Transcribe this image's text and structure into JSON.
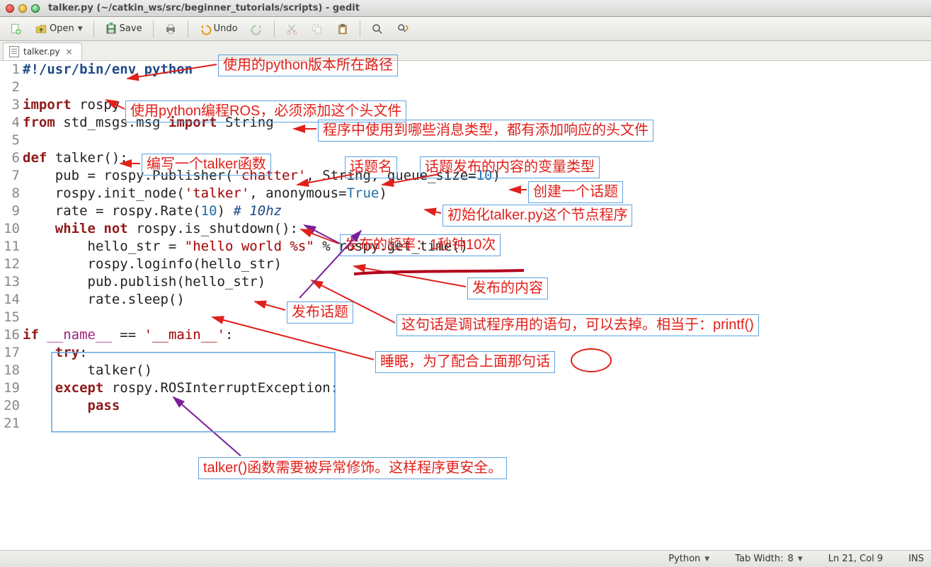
{
  "window": {
    "title": "talker.py (~/catkin_ws/src/beginner_tutorials/scripts) - gedit"
  },
  "toolbar": {
    "open": "Open",
    "save": "Save",
    "undo": "Undo"
  },
  "tabs": {
    "active": "talker.py"
  },
  "code": {
    "lines": [
      {
        "n": "1",
        "segs": [
          {
            "c": "sh",
            "t": "#!/usr/bin/env python"
          }
        ]
      },
      {
        "n": "2",
        "segs": [
          {
            "c": "plain",
            "t": " "
          }
        ]
      },
      {
        "n": "3",
        "segs": [
          {
            "c": "kw",
            "t": "import"
          },
          {
            "c": "plain",
            "t": " rospy"
          }
        ]
      },
      {
        "n": "4",
        "segs": [
          {
            "c": "kw",
            "t": "from"
          },
          {
            "c": "plain",
            "t": " std_msgs.msg "
          },
          {
            "c": "kw",
            "t": "import"
          },
          {
            "c": "plain",
            "t": " String"
          }
        ]
      },
      {
        "n": "5",
        "segs": [
          {
            "c": "plain",
            "t": " "
          }
        ]
      },
      {
        "n": "6",
        "segs": [
          {
            "c": "kw",
            "t": "def"
          },
          {
            "c": "plain",
            "t": " talker():"
          }
        ]
      },
      {
        "n": "7",
        "segs": [
          {
            "c": "plain",
            "t": "    pub = rospy.Publisher("
          },
          {
            "c": "str",
            "t": "'chatter'"
          },
          {
            "c": "plain",
            "t": ", String, queue_size="
          },
          {
            "c": "num",
            "t": "10"
          },
          {
            "c": "plain",
            "t": ")"
          }
        ]
      },
      {
        "n": "8",
        "segs": [
          {
            "c": "plain",
            "t": "    rospy.init_node("
          },
          {
            "c": "str",
            "t": "'talker'"
          },
          {
            "c": "plain",
            "t": ", anonymous="
          },
          {
            "c": "num",
            "t": "True"
          },
          {
            "c": "plain",
            "t": ")"
          }
        ]
      },
      {
        "n": "9",
        "segs": [
          {
            "c": "plain",
            "t": "    rate = rospy.Rate("
          },
          {
            "c": "num",
            "t": "10"
          },
          {
            "c": "plain",
            "t": ") "
          },
          {
            "c": "cmt",
            "t": "# 10hz"
          }
        ]
      },
      {
        "n": "10",
        "segs": [
          {
            "c": "plain",
            "t": "    "
          },
          {
            "c": "kw",
            "t": "while"
          },
          {
            "c": "plain",
            "t": " "
          },
          {
            "c": "kw",
            "t": "not"
          },
          {
            "c": "plain",
            "t": " rospy.is_shutdown():"
          }
        ]
      },
      {
        "n": "11",
        "segs": [
          {
            "c": "plain",
            "t": "        hello_str = "
          },
          {
            "c": "str",
            "t": "\"hello world %s\""
          },
          {
            "c": "plain",
            "t": " % rospy.get_time()"
          }
        ]
      },
      {
        "n": "12",
        "segs": [
          {
            "c": "plain",
            "t": "        rospy.loginfo(hello_str)"
          }
        ]
      },
      {
        "n": "13",
        "segs": [
          {
            "c": "plain",
            "t": "        pub.publish(hello_str)"
          }
        ]
      },
      {
        "n": "14",
        "segs": [
          {
            "c": "plain",
            "t": "        rate.sleep()"
          }
        ]
      },
      {
        "n": "15",
        "segs": [
          {
            "c": "plain",
            "t": " "
          }
        ]
      },
      {
        "n": "16",
        "segs": [
          {
            "c": "kw",
            "t": "if"
          },
          {
            "c": "plain",
            "t": " "
          },
          {
            "c": "mag",
            "t": "__name__"
          },
          {
            "c": "plain",
            "t": " == "
          },
          {
            "c": "str",
            "t": "'__main__'"
          },
          {
            "c": "plain",
            "t": ":"
          }
        ]
      },
      {
        "n": "17",
        "segs": [
          {
            "c": "plain",
            "t": "    "
          },
          {
            "c": "kw",
            "t": "try"
          },
          {
            "c": "plain",
            "t": ":"
          }
        ]
      },
      {
        "n": "18",
        "segs": [
          {
            "c": "plain",
            "t": "        talker()"
          }
        ]
      },
      {
        "n": "19",
        "segs": [
          {
            "c": "plain",
            "t": "    "
          },
          {
            "c": "kw",
            "t": "except"
          },
          {
            "c": "plain",
            "t": " rospy.ROSInterruptException:"
          }
        ]
      },
      {
        "n": "20",
        "segs": [
          {
            "c": "plain",
            "t": "        "
          },
          {
            "c": "kw",
            "t": "pass"
          }
        ]
      },
      {
        "n": "21",
        "segs": [
          {
            "c": "plain",
            "t": " "
          }
        ]
      }
    ]
  },
  "annotations": {
    "a1": "使用的python版本所在路径",
    "a2": "使用python编程ROS，必须添加这个头文件",
    "a3": "程序中使用到哪些消息类型，都有添加响应的头文件",
    "a4": "编写一个talker函数",
    "a5": "话题名",
    "a6": "话题发布的内容的变量类型",
    "a7": "创建一个话题",
    "a8": "初始化talker.py这个节点程序",
    "a9": "发布的频率：1秒钟10次",
    "a10": "发布的内容",
    "a11": "这句话是调试程序用的语句，可以去掉。相当于：printf()",
    "a12": "发布话题",
    "a13": "睡眠，为了配合上面那句话",
    "a14": "talker()函数需要被异常修饰。这样程序更安全。"
  },
  "status": {
    "language": "Python",
    "tab_width_label": "Tab Width:",
    "tab_width_value": "8",
    "position": "Ln 21, Col 9",
    "mode": "INS"
  }
}
